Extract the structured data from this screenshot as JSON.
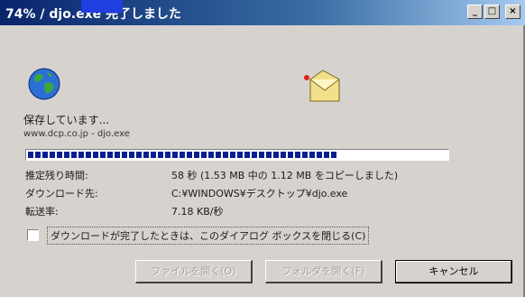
{
  "window": {
    "title": "74% / djo.exe 完了しました",
    "controls": {
      "minimize": "_",
      "maximize": "□",
      "close": "×"
    }
  },
  "icons": {
    "globe": "globe-icon",
    "folder": "folder-icon"
  },
  "status": {
    "saving_text": "保存しています...",
    "source": "www.dcp.co.jp - djo.exe",
    "progress": 0.74
  },
  "details": {
    "remaining_label": "推定残り時間:",
    "remaining_value": "58 秒 (1.53 MB 中の 1.12 MB をコピーしました)",
    "download_to_label": "ダウンロード先:",
    "download_to_value": "C:¥WINDOWS¥デスクトップ¥djo.exe",
    "rate_label": "転送率:",
    "rate_value": "7.18 KB/秒"
  },
  "checkbox": {
    "label": "ダウンロードが完了したときは、このダイアログ ボックスを閉じる(C)",
    "checked": false
  },
  "buttons": {
    "open_file": "ファイルを開く(O)",
    "open_folder": "フォルダを開く(F)",
    "cancel": "キャンセル"
  },
  "colors": {
    "title_bar": "#08246b",
    "progress": "#0a1f8f",
    "dialog_bg": "#d6d3ce"
  }
}
